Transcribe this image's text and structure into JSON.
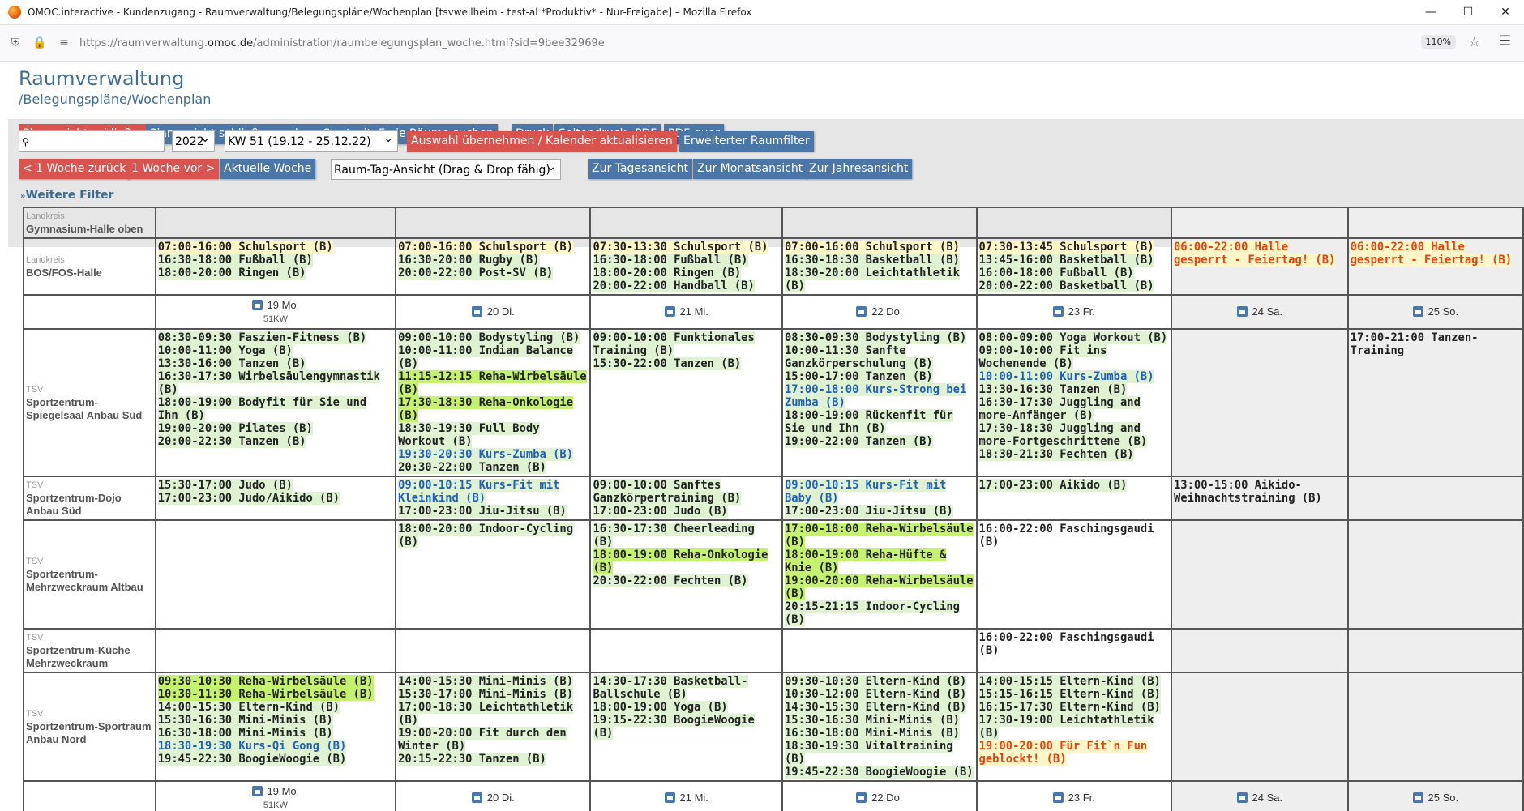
{
  "browser": {
    "window_title": "OMOC.interactive - Kundenzugang - Raumverwaltung/Belegungspläne/Wochenplan [tsvweilheim - test-al *Produktiv* - Nur-Freigabe] – Mozilla Firefox",
    "url_prefix": "https://raumverwaltung.",
    "url_domain": "omoc.de",
    "url_path": "/administration/raumbelegungsplan_woche.html?sid=9bee32969e",
    "zoom": "110%"
  },
  "header": {
    "title": "Raumverwaltung",
    "subtitle": "/Belegungspläne/Wochenplan"
  },
  "toolbar": {
    "close_plan": "Planansicht schließen",
    "close_plan_home": "Planansicht schließen und zur Startseite",
    "free_rooms": "Freie Räume suchen",
    "print": "Druck",
    "page_print": "Seitendruck",
    "pdf": "PDF",
    "pdf_landscape": "PDF quer",
    "year": "2022",
    "week": "KW 51 (19.12 - 25.12.22)",
    "apply": "Auswahl übernehmen / Kalender aktualisieren",
    "extended_filter": "Erweiterter Raumfilter",
    "prev_week": "< 1 Woche zurück",
    "next_week": "1 Woche vor >",
    "current_week": "Aktuelle Woche",
    "view_mode": "Raum-Tag-Ansicht (Drag & Drop fähig)",
    "day_view": "Zur Tagesansicht",
    "month_view": "Zur Monatsansicht",
    "year_view": "Zur Jahresansicht",
    "more_filters": "Weitere Filter"
  },
  "days": [
    {
      "label": "19 Mo.",
      "kw": "51KW"
    },
    {
      "label": "20 Di.",
      "kw": ""
    },
    {
      "label": "21 Mi.",
      "kw": ""
    },
    {
      "label": "22 Do.",
      "kw": ""
    },
    {
      "label": "23 Fr.",
      "kw": ""
    },
    {
      "label": "24 Sa.",
      "kw": ""
    },
    {
      "label": "25 So.",
      "kw": ""
    }
  ],
  "rooms": {
    "gym": {
      "org": "Landkreis",
      "name": "Gymnasium-Halle oben"
    },
    "bos": {
      "org": "Landkreis",
      "name": "BOS/FOS-Halle",
      "cells": [
        [
          "07:00-16:00 Schulsport (B)",
          "16:30-18:00 Fußball (B)",
          "18:00-20:00 Ringen (B)"
        ],
        [
          "07:00-16:00 Schulsport (B)",
          "16:30-20:00 Rugby (B)",
          "20:00-22:00 Post-SV (B)"
        ],
        [
          "07:30-13:30 Schulsport (B)",
          "16:30-18:00 Fußball (B)",
          "18:00-20:00 Ringen (B)",
          "20:00-22:00 Handball (B)"
        ],
        [
          "07:00-16:00 Schulsport (B)",
          "16:30-18:30 Basketball (B)",
          "18:30-20:00 Leichtathletik (B)"
        ],
        [
          "07:30-13:45 Schulsport (B)",
          "13:45-16:00 Basketball (B)",
          "16:00-18:00 Fußball (B)",
          "20:00-22:00 Basketball (B)"
        ],
        [
          "06:00-22:00 Halle gesperrt - Feiertag! (B)"
        ],
        [
          "06:00-22:00 Halle gesperrt - Feiertag! (B)"
        ]
      ]
    },
    "spiegel": {
      "org": "TSV",
      "name": "Sportzentrum-Spiegelsaal Anbau Süd",
      "cells": [
        [
          "08:30-09:30 Faszien-Fitness (B)",
          "10:00-11:00 Yoga (B)",
          "13:30-16:00 Tanzen (B)",
          "16:30-17:30 Wirbelsäulengymnastik (B)",
          "18:00-19:00 Bodyfit für Sie und Ihn (B)",
          "19:00-20:00 Pilates (B)",
          "20:00-22:30 Tanzen (B)"
        ],
        [
          "09:00-10:00 Bodystyling (B)",
          "10:00-11:00 Indian Balance (B)",
          "11:15-12:15 Reha-Wirbelsäule (B)",
          "17:30-18:30 Reha-Onkologie (B)",
          "18:30-19:30 Full Body Workout (B)",
          "19:30-20:30 Kurs-Zumba (B)",
          "20:30-22:00 Tanzen (B)"
        ],
        [
          "09:00-10:00 Funktionales Training (B)",
          "15:30-22:00 Tanzen (B)"
        ],
        [
          "08:30-09:30 Bodystyling (B)",
          "10:00-11:30 Sanfte Ganzkörperschulung (B)",
          "15:00-17:00 Tanzen (B)",
          "17:00-18:00 Kurs-Strong bei Zumba (B)",
          "18:00-19:00 Rückenfit für Sie und Ihn (B)",
          "19:00-22:00 Tanzen (B)"
        ],
        [
          "08:00-09:00 Yoga Workout (B)",
          "09:00-10:00 Fit ins Wochenende (B)",
          "10:00-11:00 Kurs-Zumba (B)",
          "13:30-16:30 Tanzen (B)",
          "16:30-17:30 Juggling and more-Anfänger (B)",
          "17:30-18:30 Juggling and more-Fortgeschrittene (B)",
          "18:30-21:30 Fechten (B)"
        ],
        [],
        [
          "17:00-21:00 Tanzen-Training"
        ]
      ]
    },
    "dojo": {
      "org": "TSV",
      "name": "Sportzentrum-Dojo Anbau Süd",
      "cells": [
        [
          "15:30-17:00 Judo (B)",
          "17:00-23:00 Judo/Aikido (B)"
        ],
        [
          "09:00-10:15 Kurs-Fit mit Kleinkind (B)",
          "17:00-23:00 Jiu-Jitsu (B)"
        ],
        [
          "09:00-10:00 Sanftes Ganzkörpertraining (B)",
          "17:00-23:00 Judo (B)"
        ],
        [
          "09:00-10:15 Kurs-Fit mit Baby (B)",
          "17:00-23:00 Jiu-Jitsu (B)"
        ],
        [
          "17:00-23:00 Aikido (B)"
        ],
        [
          "13:00-15:00 Aikido-Weihnachtstraining (B)"
        ],
        []
      ]
    },
    "mehr": {
      "org": "TSV",
      "name": "Sportzentrum-Mehrzweckraum Altbau",
      "cells": [
        [],
        [
          "18:00-20:00 Indoor-Cycling (B)"
        ],
        [
          "16:30-17:30 Cheerleading (B)",
          "18:00-19:00 Reha-Onkologie (B)",
          "20:30-22:00 Fechten (B)"
        ],
        [
          "17:00-18:00 Reha-Wirbelsäule (B)",
          "18:00-19:00 Reha-Hüfte & Knie (B)",
          "19:00-20:00 Reha-Wirbelsäule (B)",
          "20:15-21:15 Indoor-Cycling (B)"
        ],
        [
          "16:00-22:00 Faschingsgaudi (B)"
        ],
        [],
        []
      ]
    },
    "kueche": {
      "org": "TSV",
      "name": "Sportzentrum-Küche Mehrzweckraum",
      "cells": [
        [],
        [],
        [],
        [],
        [
          "16:00-22:00 Faschingsgaudi (B)"
        ],
        [],
        []
      ]
    },
    "nord": {
      "org": "TSV",
      "name": "Sportzentrum-Sportraum Anbau Nord",
      "cells": [
        [
          "09:30-10:30 Reha-Wirbelsäule (B)",
          "10:30-11:30 Reha-Wirbelsäule (B)",
          "14:00-15:30 Eltern-Kind (B)",
          "15:30-16:30 Mini-Minis (B)",
          "16:30-18:00 Mini-Minis (B)",
          "18:30-19:30 Kurs-Qi Gong (B)",
          "19:45-22:30 BoogieWoogie (B)"
        ],
        [
          "14:00-15:30 Mini-Minis (B)",
          "15:30-17:00 Mini-Minis (B)",
          "17:00-18:30 Leichtathletik (B)",
          "19:00-20:00 Fit durch den Winter (B)",
          "20:15-22:30 Tanzen (B)"
        ],
        [
          "14:30-17:30 Basketball-Ballschule (B)",
          "18:00-19:00 Yoga (B)",
          "19:15-22:30 BoogieWoogie (B)"
        ],
        [
          "09:30-10:30 Eltern-Kind (B)",
          "10:30-12:00 Eltern-Kind (B)",
          "14:30-15:30 Eltern-Kind (B)",
          "15:30-16:30 Mini-Minis (B)",
          "16:30-18:00 Mini-Minis (B)",
          "18:30-19:30 Vitaltraining (B)",
          "19:45-22:30 BoogieWoogie (B)"
        ],
        [
          "14:00-15:15 Eltern-Kind (B)",
          "15:15-16:15 Eltern-Kind (B)",
          "16:15-17:30 Eltern-Kind (B)",
          "17:30-19:00 Leichtathletik (B)",
          "19:00-20:00 Für Fit`n Fun geblockt! (B)"
        ],
        [],
        []
      ]
    }
  },
  "colors": {
    "red_button": "#d9534f",
    "blue_button": "#4a76a8",
    "title": "#3f6d96",
    "reha_highlight": "#c5f26e",
    "booking_green": "#dff3d3",
    "course_blue": "#1f5fbf",
    "blocked_orange": "#e8400e"
  }
}
